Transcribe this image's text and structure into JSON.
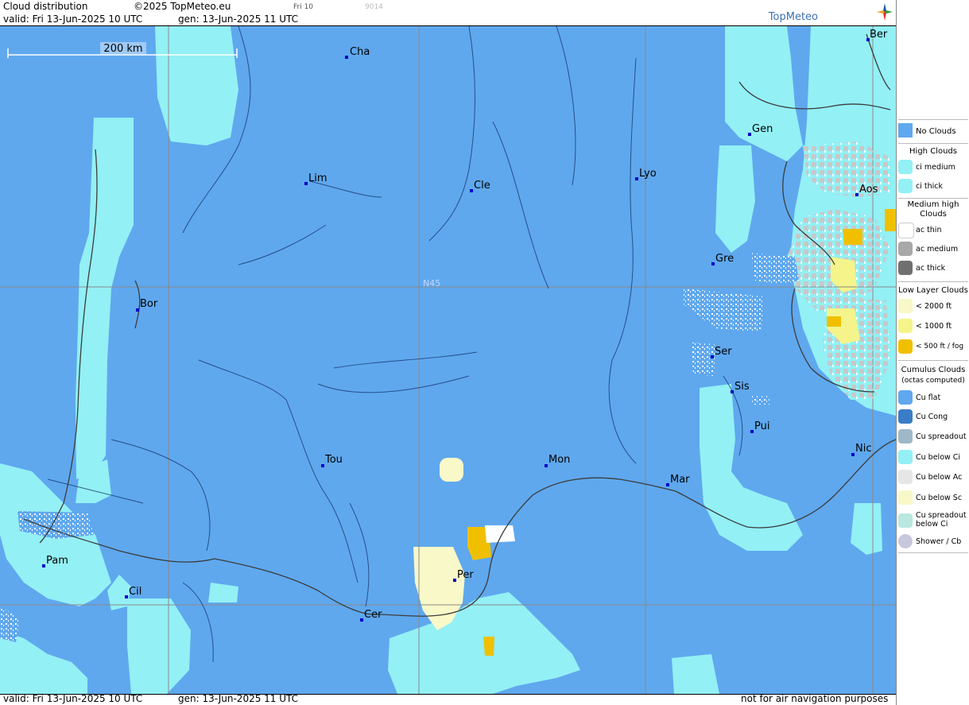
{
  "header": {
    "title": "Cloud distribution",
    "copyright": "©2025 TopMeteo.eu",
    "day_tab": "Fri 10",
    "code": "9014",
    "valid": "valid:  Fri  13-Jun-2025  10 UTC",
    "gen": "gen: 13-Jun-2025 11 UTC",
    "logo": "TopMeteo"
  },
  "footer": {
    "valid": "valid:  Fri  13-Jun-2025  10 UTC",
    "gen": "gen: 13-Jun-2025 11 UTC",
    "disclaimer": "not for air navigation purposes"
  },
  "map": {
    "scale_label": "200 km",
    "lat_label": "N45",
    "colors": {
      "no_clouds": "#5fa8ee",
      "ci": "#93f0f5",
      "low": "#f8f8c8",
      "fog": "#f0c000",
      "ac": "#c8c8c8"
    },
    "cities": [
      {
        "name": "Cha"
      },
      {
        "name": "Ber"
      },
      {
        "name": "Gen"
      },
      {
        "name": "Lim"
      },
      {
        "name": "Cle"
      },
      {
        "name": "Lyo"
      },
      {
        "name": "Aos"
      },
      {
        "name": "Gre"
      },
      {
        "name": "Bor"
      },
      {
        "name": "Ser"
      },
      {
        "name": "Sis"
      },
      {
        "name": "Pui"
      },
      {
        "name": "Tou"
      },
      {
        "name": "Mon"
      },
      {
        "name": "Mar"
      },
      {
        "name": "Nic"
      },
      {
        "name": "Pam"
      },
      {
        "name": "Per"
      },
      {
        "name": "Cil"
      },
      {
        "name": "Cer"
      }
    ]
  },
  "legend": {
    "no_clouds": "No Clouds",
    "high_clouds": "High Clouds",
    "ci_medium": "ci medium",
    "ci_thick": "ci thick",
    "medium_high": "Medium high Clouds",
    "ac_thin": "ac thin",
    "ac_medium": "ac medium",
    "ac_thick": "ac thick",
    "low_layer": "Low Layer Clouds",
    "lt2000": "< 2000 ft",
    "lt1000": "< 1000 ft",
    "lt500": "< 500 ft / fog",
    "cumulus": "Cumulus Clouds",
    "octas": "(octas computed)",
    "cu_flat": "Cu flat",
    "cu_cong": "Cu Cong",
    "cu_spread": "Cu spreadout",
    "cu_below_ci": "Cu below Ci",
    "cu_below_ac": "Cu below Ac",
    "cu_below_sc": "Cu below Sc",
    "cu_spread_ci": "Cu spreadout below Ci",
    "shower": "Shower / Cb"
  }
}
